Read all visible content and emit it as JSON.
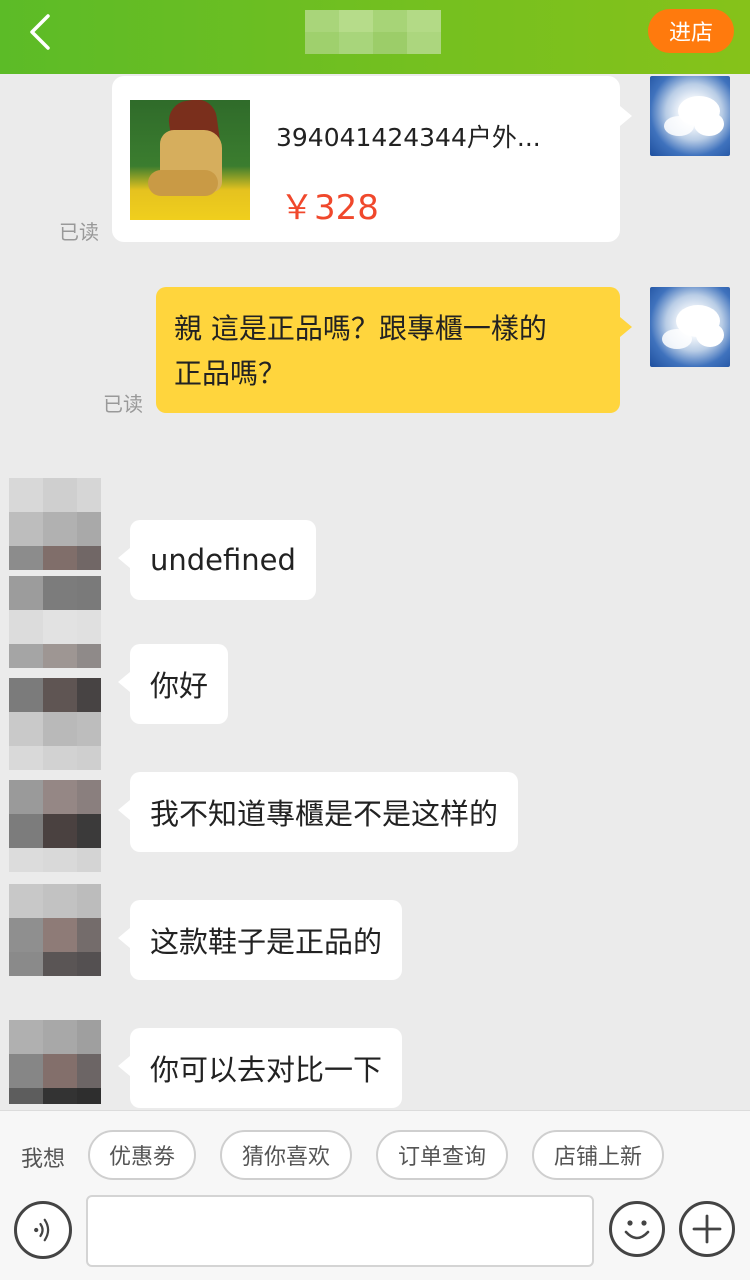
{
  "header": {
    "enter_store_label": "进店",
    "accent_color": "#6fbf22",
    "button_color": "#ff7a0d"
  },
  "messages": {
    "product_card": {
      "title": "394041424344户外...",
      "price": "￥328",
      "read_status": "已读"
    },
    "user_question": {
      "line1": "親 這是正品嗎？跟專櫃一樣的",
      "line2": "正品嗎？",
      "read_status": "已读"
    },
    "replies": [
      {
        "text": "undefined"
      },
      {
        "text": "你好"
      },
      {
        "text": "我不知道專櫃是不是这样的"
      },
      {
        "text": "这款鞋子是正品的"
      },
      {
        "text": "你可以去对比一下"
      }
    ]
  },
  "bottom_bar": {
    "want_label": "我想",
    "chips": [
      "优惠劵",
      "猜你喜欢",
      "订单查询",
      "店铺上新"
    ],
    "icons": [
      "voice-icon",
      "emoji-icon",
      "plus-icon"
    ]
  }
}
